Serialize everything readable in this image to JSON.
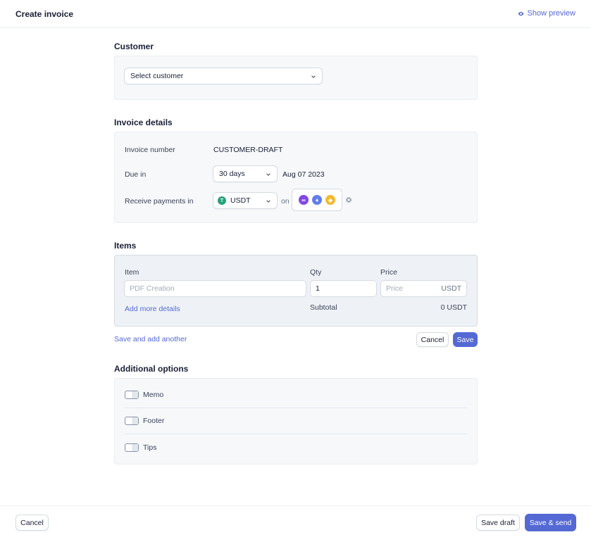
{
  "header": {
    "title": "Create invoice",
    "show_preview": "Show preview"
  },
  "customer": {
    "section_title": "Customer",
    "select_placeholder": "Select customer"
  },
  "invoice_details": {
    "section_title": "Invoice details",
    "invoice_number_label": "Invoice number",
    "invoice_number_value": "CUSTOMER-DRAFT",
    "due_in_label": "Due in",
    "due_in_value": "30 days",
    "due_date": "Aug 07 2023",
    "receive_label": "Receive payments in",
    "currency": "USDT",
    "on_label": "on",
    "networks": [
      "polygon-icon",
      "ethereum-icon",
      "bnb-icon"
    ]
  },
  "items": {
    "section_title": "Items",
    "col_item": "Item",
    "col_qty": "Qty",
    "col_price": "Price",
    "item_placeholder": "PDF Creation",
    "qty_value": "1",
    "price_placeholder": "Price",
    "price_suffix": "USDT",
    "add_more": "Add more details",
    "subtotal_label": "Subtotal",
    "subtotal_value": "0 USDT",
    "save_and_add": "Save and add another",
    "cancel": "Cancel",
    "save": "Save"
  },
  "additional": {
    "section_title": "Additional options",
    "options": [
      "Memo",
      "Footer",
      "Tips"
    ]
  },
  "footer": {
    "cancel": "Cancel",
    "save_draft": "Save draft",
    "save_send": "Save & send"
  },
  "colors": {
    "accent": "#5469d4",
    "panel_bg": "#f6f8fa",
    "tether": "#26a17b",
    "polygon": "#8247e5",
    "ethereum": "#627eea",
    "bnb": "#f3ba2f"
  }
}
